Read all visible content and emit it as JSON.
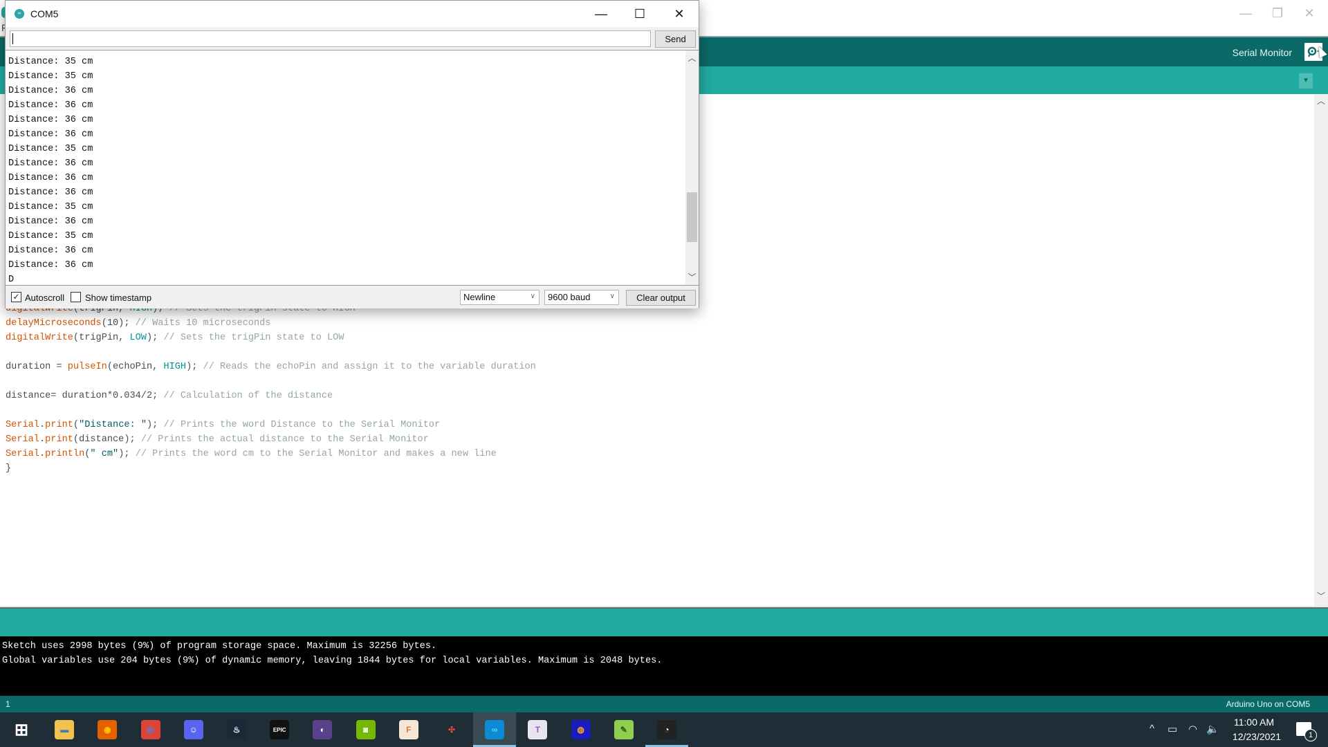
{
  "ide": {
    "window_controls": {
      "minimize": "—",
      "restore": "❐",
      "close": "✕"
    },
    "toolbar": {
      "serial_monitor_label": "Serial Monitor",
      "serial_monitor_icon": "magnifier-serial-icon"
    },
    "tab_menu_icon": "▼",
    "menu_partial": "F",
    "code_lines": [
      {
        "parts": [
          {
            "t": "digitalWrite",
            "c": "kw-fn"
          },
          {
            "t": "(trigPin, "
          },
          {
            "t": "HIGH",
            "c": "kw-const"
          },
          {
            "t": "); "
          },
          {
            "t": "// Sets the trigPin state to HIGH",
            "c": "kw-cm"
          }
        ]
      },
      {
        "parts": [
          {
            "t": "delayMicroseconds",
            "c": "kw-fn"
          },
          {
            "t": "(10); "
          },
          {
            "t": "// Waits 10 microseconds",
            "c": "kw-cm"
          }
        ]
      },
      {
        "parts": [
          {
            "t": "digitalWrite",
            "c": "kw-fn"
          },
          {
            "t": "(trigPin, "
          },
          {
            "t": "LOW",
            "c": "kw-const"
          },
          {
            "t": "); "
          },
          {
            "t": "// Sets the trigPin state to LOW",
            "c": "kw-cm"
          }
        ]
      },
      {
        "parts": [
          {
            "t": ""
          }
        ]
      },
      {
        "parts": [
          {
            "t": "duration = "
          },
          {
            "t": "pulseIn",
            "c": "kw-fn"
          },
          {
            "t": "(echoPin, "
          },
          {
            "t": "HIGH",
            "c": "kw-const"
          },
          {
            "t": "); "
          },
          {
            "t": "// Reads the echoPin and assign it to the variable duration",
            "c": "kw-cm"
          }
        ]
      },
      {
        "parts": [
          {
            "t": ""
          }
        ]
      },
      {
        "parts": [
          {
            "t": "distance= duration*0.034/2; "
          },
          {
            "t": "// Calculation of the distance",
            "c": "kw-cm"
          }
        ]
      },
      {
        "parts": [
          {
            "t": ""
          }
        ]
      },
      {
        "parts": [
          {
            "t": "Serial",
            "c": "kw-serial"
          },
          {
            "t": "."
          },
          {
            "t": "print",
            "c": "kw-fn"
          },
          {
            "t": "("
          },
          {
            "t": "\"Distance: \"",
            "c": "kw-str"
          },
          {
            "t": "); "
          },
          {
            "t": "// Prints the word Distance to the Serial Monitor",
            "c": "kw-cm"
          }
        ]
      },
      {
        "parts": [
          {
            "t": "Serial",
            "c": "kw-serial"
          },
          {
            "t": "."
          },
          {
            "t": "print",
            "c": "kw-fn"
          },
          {
            "t": "(distance); "
          },
          {
            "t": "// Prints the actual distance to the Serial Monitor",
            "c": "kw-cm"
          }
        ]
      },
      {
        "parts": [
          {
            "t": "Serial",
            "c": "kw-serial"
          },
          {
            "t": "."
          },
          {
            "t": "println",
            "c": "kw-fn"
          },
          {
            "t": "("
          },
          {
            "t": "\" cm\"",
            "c": "kw-str"
          },
          {
            "t": "); "
          },
          {
            "t": "// Prints the word cm to the Serial Monitor and makes a new line",
            "c": "kw-cm"
          }
        ]
      },
      {
        "parts": [
          {
            "t": "}"
          }
        ]
      }
    ],
    "console_lines": [
      "Sketch uses 2998 bytes (9%) of program storage space. Maximum is 32256 bytes.",
      "Global variables use 204 bytes (9%) of dynamic memory, leaving 1844 bytes for local variables. Maximum is 2048 bytes."
    ],
    "status": {
      "line_number": "1",
      "board": "Arduino Uno on COM5"
    }
  },
  "serial_monitor": {
    "title": "COM5",
    "window_controls": {
      "minimize": "—",
      "maximize": "☐",
      "close": "✕"
    },
    "input_value": "",
    "send_label": "Send",
    "output_lines": [
      "Distance: 35 cm",
      "Distance: 35 cm",
      "Distance: 36 cm",
      "Distance: 36 cm",
      "Distance: 36 cm",
      "Distance: 36 cm",
      "Distance: 35 cm",
      "Distance: 36 cm",
      "Distance: 36 cm",
      "Distance: 36 cm",
      "Distance: 35 cm",
      "Distance: 36 cm",
      "Distance: 35 cm",
      "Distance: 36 cm",
      "Distance: 36 cm",
      "D"
    ],
    "scroll": {
      "thumb_start": 0.62,
      "thumb_end": 0.86
    },
    "autoscroll": {
      "label": "Autoscroll",
      "checked": true
    },
    "show_timestamp": {
      "label": "Show timestamp",
      "checked": false
    },
    "line_ending": "Newline",
    "baud_rate": "9600 baud",
    "clear_label": "Clear output"
  },
  "taskbar": {
    "apps": [
      {
        "name": "start",
        "glyph": "⊞",
        "bg": "transparent",
        "fg": "#ffffff"
      },
      {
        "name": "file-explorer",
        "glyph": "▬",
        "bg": "#f2c14e",
        "fg": "#3d7ab8"
      },
      {
        "name": "firefox",
        "glyph": "◉",
        "bg": "#e66000",
        "fg": "#ffcb00"
      },
      {
        "name": "chrome",
        "glyph": "◎",
        "bg": "#db4437",
        "fg": "#4285f4"
      },
      {
        "name": "discord",
        "glyph": "☺",
        "bg": "#5865f2",
        "fg": "#ffffff"
      },
      {
        "name": "steam",
        "glyph": "♨",
        "bg": "#1b2838",
        "fg": "#ffffff"
      },
      {
        "name": "epic-games",
        "glyph": "EPIC",
        "bg": "#111111",
        "fg": "#ffffff"
      },
      {
        "name": "ubisoft-connect",
        "glyph": "◐",
        "bg": "#5a3f8a",
        "fg": "#ffffff"
      },
      {
        "name": "nvidia",
        "glyph": "◙",
        "bg": "#76b900",
        "fg": "#ffffff"
      },
      {
        "name": "fusion-360",
        "glyph": "F",
        "bg": "#f5e6d8",
        "fg": "#e07b2c"
      },
      {
        "name": "app-launcher",
        "glyph": "✣",
        "bg": "transparent",
        "fg": "#e74c3c"
      },
      {
        "name": "arduino-ide",
        "glyph": "∞",
        "bg": "#0c8ad6",
        "fg": "#5fe0d8",
        "active": true
      },
      {
        "name": "typora",
        "glyph": "T",
        "bg": "#e8e4f0",
        "fg": "#8b5fbf"
      },
      {
        "name": "audacity",
        "glyph": "◍",
        "bg": "#1b1bbf",
        "fg": "#f5a623"
      },
      {
        "name": "notepad-plus-plus",
        "glyph": "✎",
        "bg": "#8fd14f",
        "fg": "#2d5e1a"
      },
      {
        "name": "obs-studio",
        "glyph": "◔",
        "bg": "#222222",
        "fg": "#ffffff",
        "running": true
      }
    ],
    "tray": {
      "chevron": "^",
      "battery": "▭",
      "wifi": "◠",
      "volume": "🔈",
      "time": "11:00 AM",
      "date": "12/23/2021",
      "notification_count": "1"
    }
  }
}
